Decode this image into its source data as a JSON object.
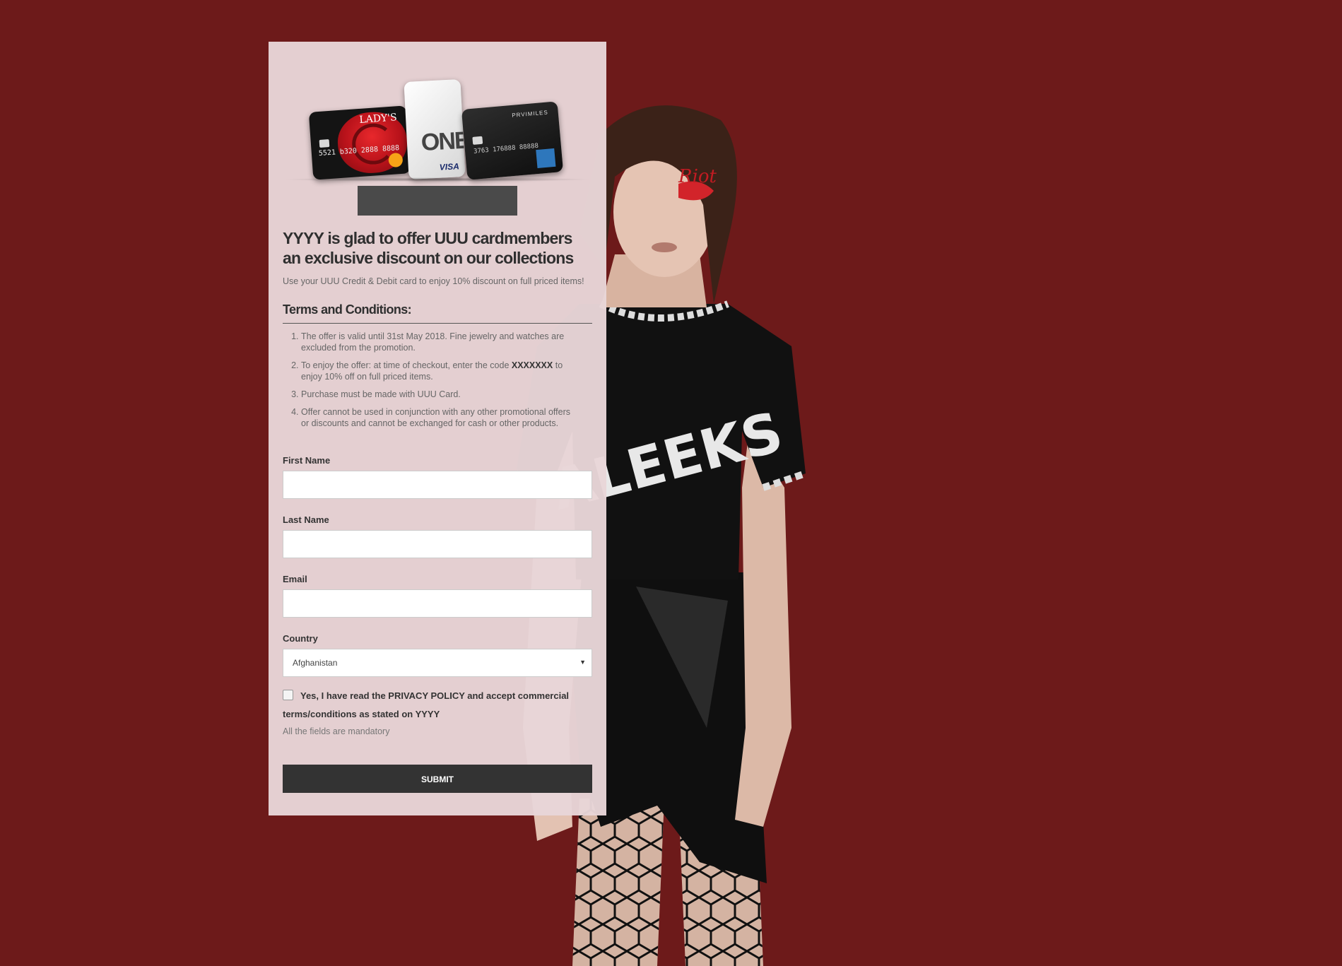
{
  "colors": {
    "background": "#6d1a1a",
    "panel": "#e8d6d8",
    "button": "#333333"
  },
  "cards": {
    "ladys_card_title": "LADY'S",
    "ladys_card_number": "5521 b320 2888 8888",
    "one_card_label": "ONE",
    "visa_label": "VISA",
    "miles_card_brand": "PRVIMILES",
    "miles_card_number": "3763 176888 88888"
  },
  "headline": "YYYY is glad to offer UUU cardmembers an exclusive discount on our collections",
  "intro": "Use your UUU Credit & Debit card to enjoy 10% discount on full priced items!",
  "terms": {
    "title": "Terms and Conditions:",
    "item1": "The offer is valid until 31st May 2018. Fine jewelry and watches are excluded from the promotion.",
    "item2_before": "To enjoy the offer: at time of checkout, enter the code ",
    "item2_code": "XXXXXXX",
    "item2_after": " to enjoy 10% off on full priced items.",
    "item3": "Purchase must be made with UUU Card.",
    "item4": "Offer cannot be used in conjunction with any other promotional offers or discounts and cannot be exchanged for cash or other products."
  },
  "form": {
    "first_name_label": "First Name",
    "first_name_value": "",
    "last_name_label": "Last Name",
    "last_name_value": "",
    "email_label": "Email",
    "email_value": "",
    "country_label": "Country",
    "country_value": "Afghanistan",
    "consent_text": "Yes, I have read the PRIVACY POLICY and accept commercial terms/conditions as stated on YYYY",
    "mandatory_note": "All the fields are mandatory",
    "submit_label": "SUBMIT"
  },
  "model_shirt_text": "ALEEKS",
  "model_face_text": "Riot"
}
